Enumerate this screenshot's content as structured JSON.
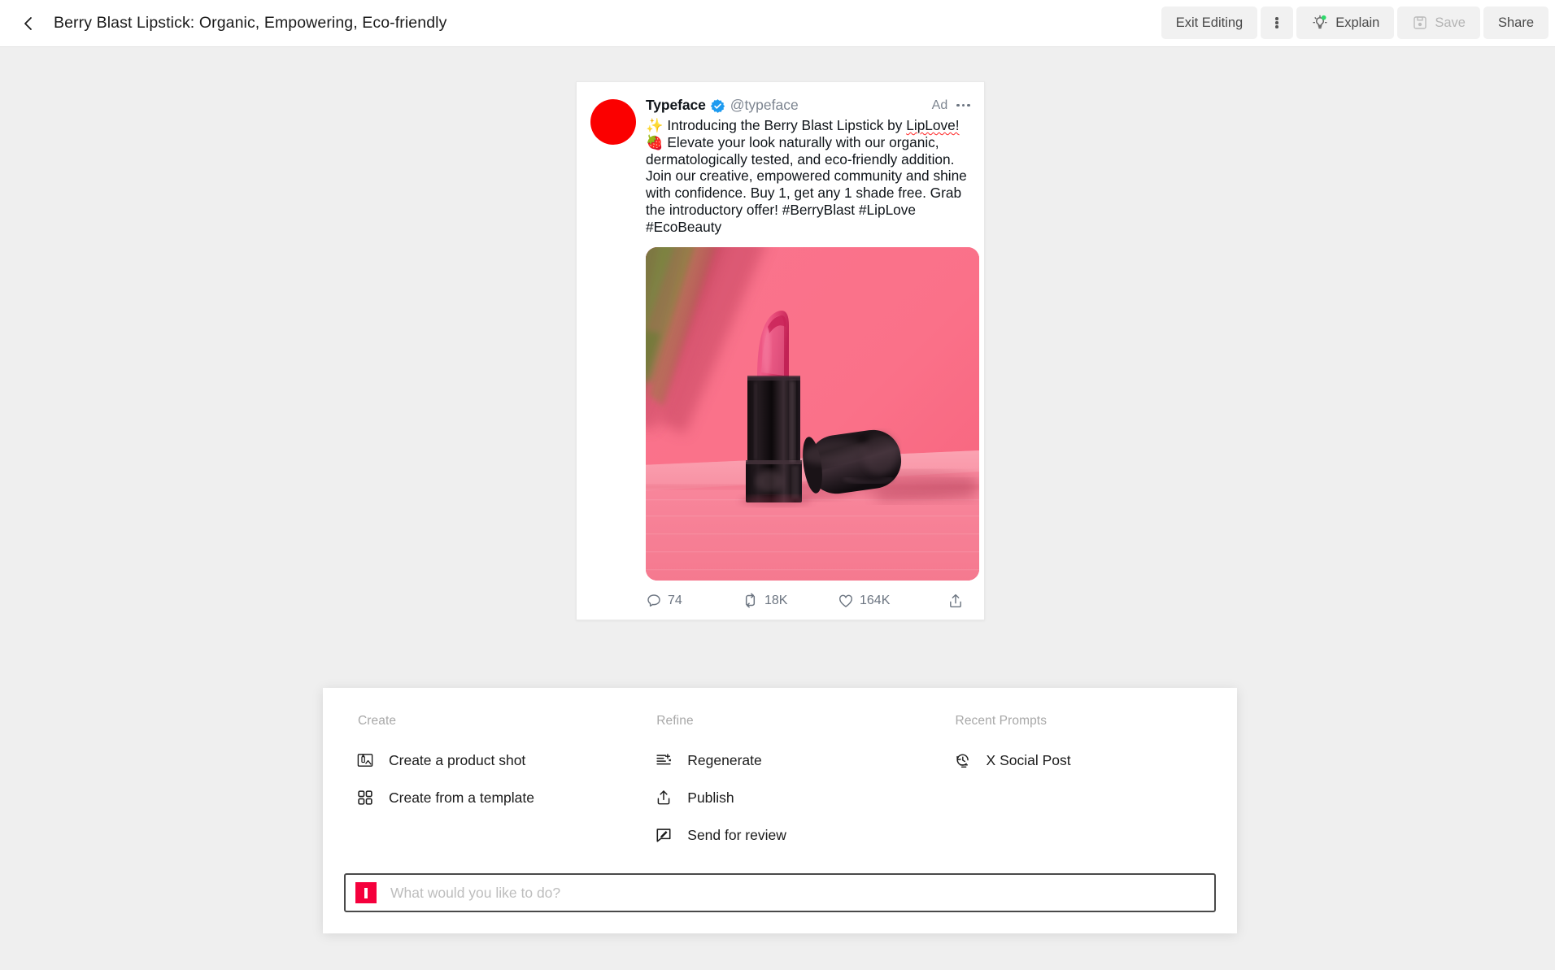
{
  "topbar": {
    "back_icon": "chevron-left-icon",
    "title": "Berry Blast Lipstick: Organic, Empowering, Eco-friendly",
    "exit_editing_label": "Exit Editing",
    "more_icon": "kebab-menu-icon",
    "explain_label": "Explain",
    "explain_icon": "lightbulb-idea-icon",
    "save_label": "Save",
    "save_icon": "floppy-disk-icon",
    "share_label": "Share"
  },
  "post": {
    "avatar_color": "#fb0000",
    "display_name": "Typeface",
    "verified_icon": "verified-badge-icon",
    "verified_color": "#1d9bf0",
    "handle": "@typeface",
    "ad_label": "Ad",
    "more_icon": "more-options-icon",
    "text_line_1": "✨ Introducing the Berry Blast Lipstick by ",
    "text_misspelled": "LipLove!",
    "text_rest": " 🍓 Elevate your look naturally with our organic, dermatologically tested, and eco-friendly addition. Join our creative, empowered community and shine with confidence. Buy 1, get any 1 shade free. Grab the introductory offer! #BerryBlast #LipLove #EcoBeauty",
    "media_alt": "pink lipstick on pink pedestal with palm leaf shadow",
    "actions": [
      {
        "icon": "reply-icon",
        "count": "74"
      },
      {
        "icon": "retweet-icon",
        "count": "18K"
      },
      {
        "icon": "heart-icon",
        "count": "164K"
      },
      {
        "icon": "share-upload-icon",
        "count": ""
      }
    ]
  },
  "command_panel": {
    "columns": [
      {
        "heading": "Create",
        "items": [
          {
            "icon": "product-shot-icon",
            "label": "Create a product shot"
          },
          {
            "icon": "template-grid-icon",
            "label": "Create from a template"
          }
        ]
      },
      {
        "heading": "Refine",
        "items": [
          {
            "icon": "regenerate-icon",
            "label": "Regenerate"
          },
          {
            "icon": "publish-upload-icon",
            "label": "Publish"
          },
          {
            "icon": "send-for-review-icon",
            "label": "Send for review"
          }
        ]
      },
      {
        "heading": "Recent Prompts",
        "items": [
          {
            "icon": "recent-history-icon",
            "label": "X Social Post"
          }
        ]
      }
    ],
    "prompt": {
      "logo_icon": "typeface-logo-icon",
      "logo_color": "#f5003c",
      "placeholder": "What would you like to do?",
      "value": ""
    }
  }
}
